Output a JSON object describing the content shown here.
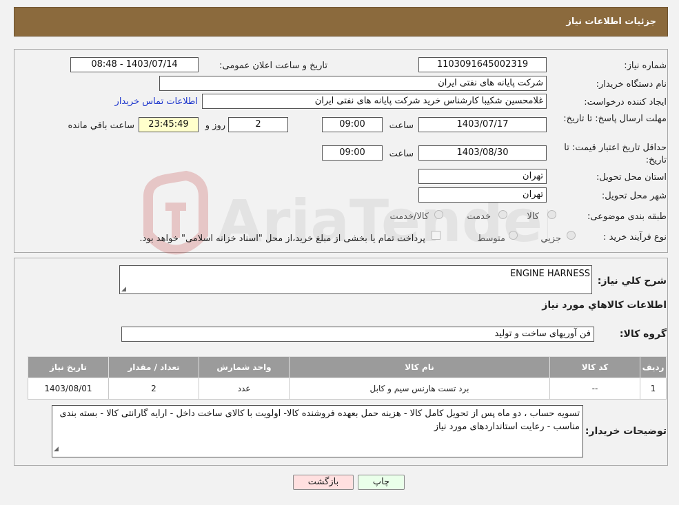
{
  "header": {
    "title": "جزئیات اطلاعات نیاز"
  },
  "watermark": {
    "text": "AriaTender.neT"
  },
  "form": {
    "need_number_label": "شماره نیاز:",
    "need_number": "1103091645002319",
    "announce_label": "تاریخ و ساعت اعلان عمومی:",
    "announce_value": "1403/07/14 - 08:48",
    "buyer_org_label": "نام دستگاه خریدار:",
    "buyer_org": "شرکت پایانه های نفتی ایران",
    "creator_label": "ایجاد کننده درخواست:",
    "creator": "غلامحسین شکیبا کارشناس خرید شرکت پایانه های نفتی ایران",
    "contact_link": "اطلاعات تماس خریدار",
    "deadline_label": "مهلت ارسال پاسخ: تا تاریخ:",
    "deadline_date": "1403/07/17",
    "time_label": "ساعت",
    "deadline_time": "09:00",
    "days": "2",
    "days_label": "روز و",
    "remaining": "23:45:49",
    "remaining_label": "ساعت باقي مانده",
    "validity_label": "حداقل تاریخ اعتبار قیمت: تا تاریخ:",
    "validity_date": "1403/08/30",
    "validity_time": "09:00",
    "province_label": "استان محل تحویل:",
    "province": "تهران",
    "city_label": "شهر محل تحویل:",
    "city": "تهران",
    "category_label": "طبقه بندی موضوعی:",
    "category_options": [
      "کالا",
      "خدمت",
      "کالا/خدمت"
    ],
    "process_label": "نوع فرآیند خرید :",
    "process_options": [
      "جزیي",
      "متوسط"
    ],
    "payment_note": "پرداخت تمام یا بخشی از مبلغ خرید،از محل \"اسناد خزانه اسلامی\" خواهد بود."
  },
  "details": {
    "summary_label": "شرح کلي نياز:",
    "summary": "ENGINE HARNESS",
    "items_title": "اطلاعات کالاهاي مورد نياز",
    "group_label": "گروه کالا:",
    "group": "فن آوریهای ساخت و تولید",
    "table": {
      "headers": [
        "رديف",
        "کد کالا",
        "نام کالا",
        "واحد شمارش",
        "تعداد / مقدار",
        "تاريخ نياز"
      ],
      "rows": [
        [
          "1",
          "--",
          "برد تست هارنس سیم و کابل",
          "عدد",
          "2",
          "1403/08/01"
        ]
      ]
    },
    "buyer_notes_label": "توضيحات خريدار:",
    "buyer_notes": "تسویه حساب ، دو ماه پس از تحویل کامل کالا - هزینه حمل بعهده فروشنده کالا- اولویت با کالای ساخت داخل - ارایه گارانتی کالا - بسته بندی مناسب - رعایت استانداردهای مورد نیاز"
  },
  "buttons": {
    "print": "چاپ",
    "back": "بازگشت"
  },
  "colors": {
    "header": "#8b6a3d",
    "link": "#1a33cc",
    "back_button": "#ffe0e0",
    "print_button": "#eaffea"
  }
}
